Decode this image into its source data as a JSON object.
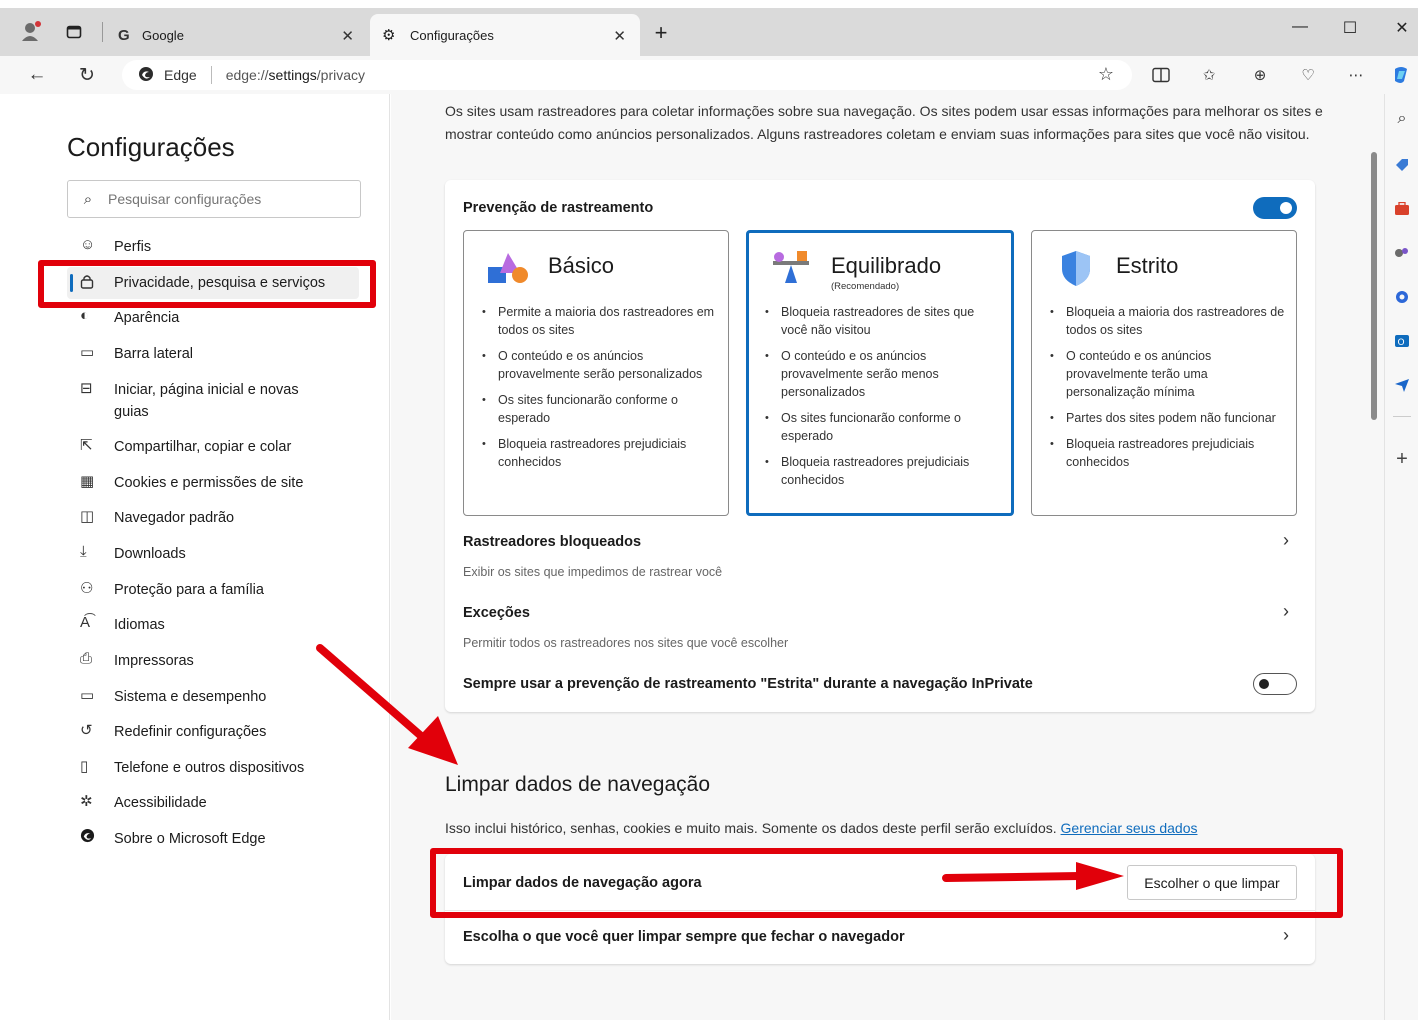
{
  "tabs": [
    {
      "label": "Google",
      "icon": "google-g-icon"
    },
    {
      "label": "Configurações",
      "icon": "gear-icon"
    }
  ],
  "address": {
    "site_label": "Edge",
    "url_prefix": "edge://",
    "url_bold": "settings",
    "url_suffix": "/privacy"
  },
  "settings_nav": {
    "title": "Configurações",
    "search_placeholder": "Pesquisar configurações",
    "items": [
      {
        "label": "Perfis",
        "icon": "profile-icon"
      },
      {
        "label": "Privacidade, pesquisa e serviços",
        "icon": "lock-icon"
      },
      {
        "label": "Aparência",
        "icon": "palette-icon"
      },
      {
        "label": "Barra lateral",
        "icon": "sidebar-icon"
      },
      {
        "label": "Iniciar, página inicial e novas guias",
        "icon": "home-tabs-icon"
      },
      {
        "label": "Compartilhar, copiar e colar",
        "icon": "share-icon"
      },
      {
        "label": "Cookies e permissões de site",
        "icon": "cookies-icon"
      },
      {
        "label": "Navegador padrão",
        "icon": "default-browser-icon"
      },
      {
        "label": "Downloads",
        "icon": "download-icon"
      },
      {
        "label": "Proteção para a família",
        "icon": "family-icon"
      },
      {
        "label": "Idiomas",
        "icon": "languages-icon"
      },
      {
        "label": "Impressoras",
        "icon": "printer-icon"
      },
      {
        "label": "Sistema e desempenho",
        "icon": "laptop-icon"
      },
      {
        "label": "Redefinir configurações",
        "icon": "reset-icon"
      },
      {
        "label": "Telefone e outros dispositivos",
        "icon": "phone-icon"
      },
      {
        "label": "Acessibilidade",
        "icon": "accessibility-icon"
      },
      {
        "label": "Sobre o Microsoft Edge",
        "icon": "edge-logo-icon"
      }
    ]
  },
  "content": {
    "intro": "Os sites usam rastreadores para coletar informações sobre sua navegação. Os sites podem usar essas informações para melhorar os sites e mostrar conteúdo como anúncios personalizados. Alguns rastreadores coletam e enviam suas informações para sites que você não visitou.",
    "tracking_prevention": {
      "title": "Prevenção de rastreamento",
      "enabled": true,
      "options": [
        {
          "title": "Básico",
          "subtitle": "",
          "selected": false,
          "bullets": [
            "Permite a maioria dos rastreadores em todos os sites",
            "O conteúdo e os anúncios provavelmente serão personalizados",
            "Os sites funcionarão conforme o esperado",
            "Bloqueia rastreadores prejudiciais conhecidos"
          ]
        },
        {
          "title": "Equilibrado",
          "subtitle": "(Recomendado)",
          "selected": true,
          "bullets": [
            "Bloqueia rastreadores de sites que você não visitou",
            "O conteúdo e os anúncios provavelmente serão menos personalizados",
            "Os sites funcionarão conforme o esperado",
            "Bloqueia rastreadores prejudiciais conhecidos"
          ]
        },
        {
          "title": "Estrito",
          "subtitle": "",
          "selected": false,
          "bullets": [
            "Bloqueia a maioria dos rastreadores de todos os sites",
            "O conteúdo e os anúncios provavelmente terão uma personalização mínima",
            "Partes dos sites podem não funcionar",
            "Bloqueia rastreadores prejudiciais conhecidos"
          ]
        }
      ],
      "blocked_title": "Rastreadores bloqueados",
      "blocked_desc": "Exibir os sites que impedimos de rastrear você",
      "exceptions_title": "Exceções",
      "exceptions_desc": "Permitir todos os rastreadores nos sites que você escolher",
      "inprivate_label": "Sempre usar a prevenção de rastreamento \"Estrita\" durante a navegação InPrivate",
      "inprivate_enabled": false
    },
    "clear_data": {
      "heading": "Limpar dados de navegação",
      "desc": "Isso inclui histórico, senhas, cookies e muito mais. Somente os dados deste perfil serão excluídos.",
      "manage_link": "Gerenciar seus dados",
      "clear_now_label": "Limpar dados de navegação agora",
      "choose_button": "Escolher o que limpar",
      "on_close_label": "Escolha o que você quer limpar sempre que fechar o navegador"
    }
  },
  "colors": {
    "accent": "#0f6cbd",
    "annotation_red": "#e1000a"
  }
}
